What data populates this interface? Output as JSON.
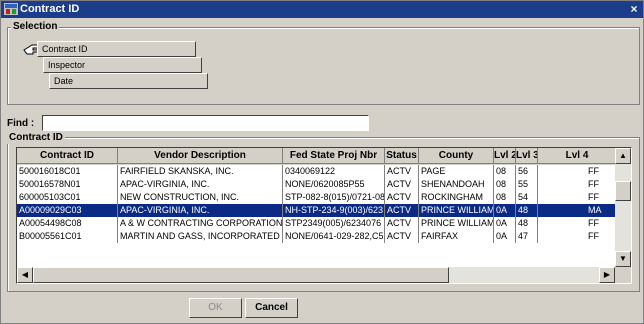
{
  "window": {
    "title": "Contract ID",
    "close_glyph": "×"
  },
  "selection": {
    "label": "Selection",
    "tree": [
      "Contract ID",
      "Inspector",
      "Date"
    ]
  },
  "find": {
    "label": "Find :",
    "value": ""
  },
  "list": {
    "label": "Contract ID",
    "columns": [
      "Contract ID",
      "Vendor Description",
      "Fed State Proj Nbr",
      "Status",
      "County",
      "Lvl 2",
      "Lvl 3",
      "Lvl 4"
    ],
    "rows": [
      [
        "500016018C01",
        "FAIRFIELD SKANSKA, INC.",
        "0340069122",
        "ACTV",
        "PAGE",
        "08",
        "56",
        "FF"
      ],
      [
        "500016578N01",
        "APAC-VIRGINIA, INC.",
        "NONE/0620085P55",
        "ACTV",
        "SHENANDOAH",
        "08",
        "55",
        "FF"
      ],
      [
        "600005103C01",
        "NEW CONSTRUCTION, INC.",
        "STP-082-8(015)/0721-08",
        "ACTV",
        "ROCKINGHAM",
        "08",
        "54",
        "FF"
      ],
      [
        "A00009029C03",
        "APAC-VIRGINIA, INC.",
        "NH-STP-234-9(003)/623",
        "ACTV",
        "PRINCE WILLIAM",
        "0A",
        "48",
        "MA"
      ],
      [
        "A00054498C08",
        "A & W CONTRACTING CORPORATION",
        "STP2349(005)/6234076",
        "ACTV",
        "PRINCE WILLIAM",
        "0A",
        "48",
        "FF"
      ],
      [
        "B00005561C01",
        "MARTIN AND GASS, INCORPORATED",
        "NONE/0641-029-282,C5",
        "ACTV",
        "FAIRFAX",
        "0A",
        "47",
        "FF"
      ]
    ],
    "selected_row": 3
  },
  "buttons": {
    "ok": "OK",
    "cancel": "Cancel"
  },
  "colors": {
    "titlebar": "#1c3d8c",
    "selection": "#0a2a85",
    "window_bg": "#d4d0c8"
  }
}
